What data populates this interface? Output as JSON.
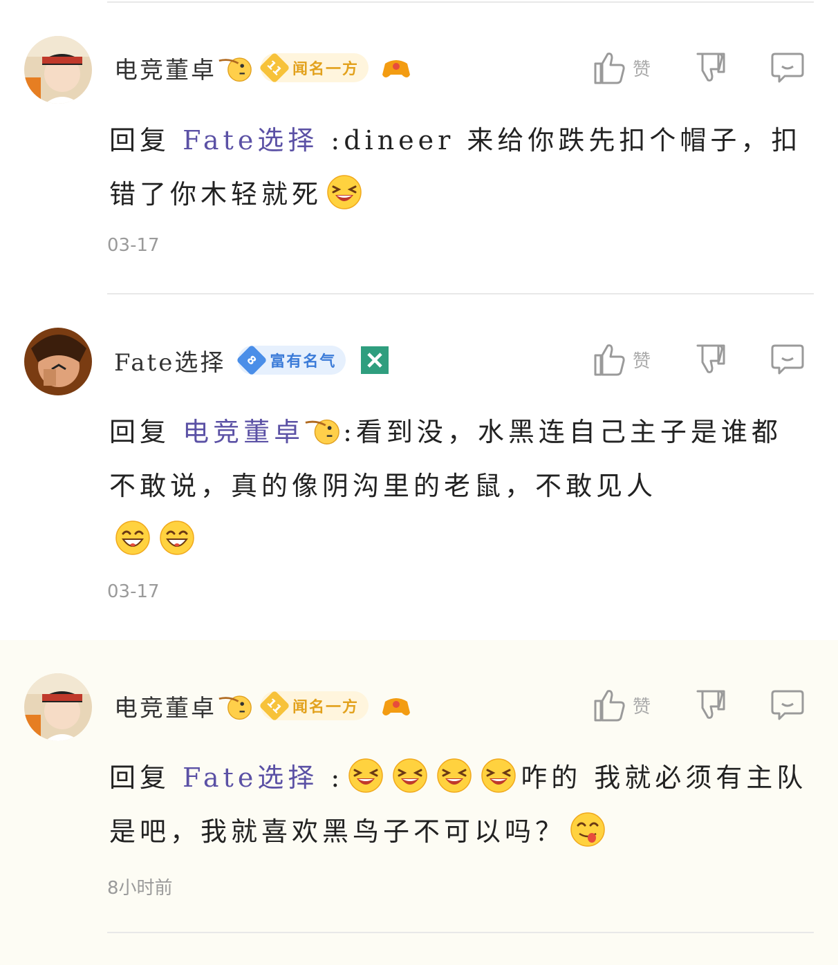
{
  "comments": [
    {
      "username": "电竞董卓",
      "level": "11",
      "level_title": "闻名一方",
      "like_label": "赞",
      "reply_prefix": "回复",
      "mention": "Fate选择",
      "text_before": ":dineer 来给你跌先扣个帽子，扣错了你木轻就死",
      "date": "03-17"
    },
    {
      "username": "Fate选择",
      "level": "8",
      "level_title": "富有名气",
      "like_label": "赞",
      "reply_prefix": "回复",
      "mention": "电竞董卓",
      "text_before": ":看到没，水黑连自己主子是谁都不敢说，真的像阴沟里的老鼠，不敢见人",
      "date": "03-17"
    },
    {
      "username": "电竞董卓",
      "level": "11",
      "level_title": "闻名一方",
      "like_label": "赞",
      "reply_prefix": "回复",
      "mention": "Fate选择",
      "text_mid": ":",
      "text_after": "咋的 我就必须有主队是吧，我就喜欢黑鸟子不可以吗？",
      "date": "8小时前"
    }
  ],
  "colors": {
    "mention": "#5b51a5",
    "gold_badge": "#f7c23a",
    "blue_badge": "#4a8ee8",
    "highlight_bg": "#fdfcf4"
  }
}
